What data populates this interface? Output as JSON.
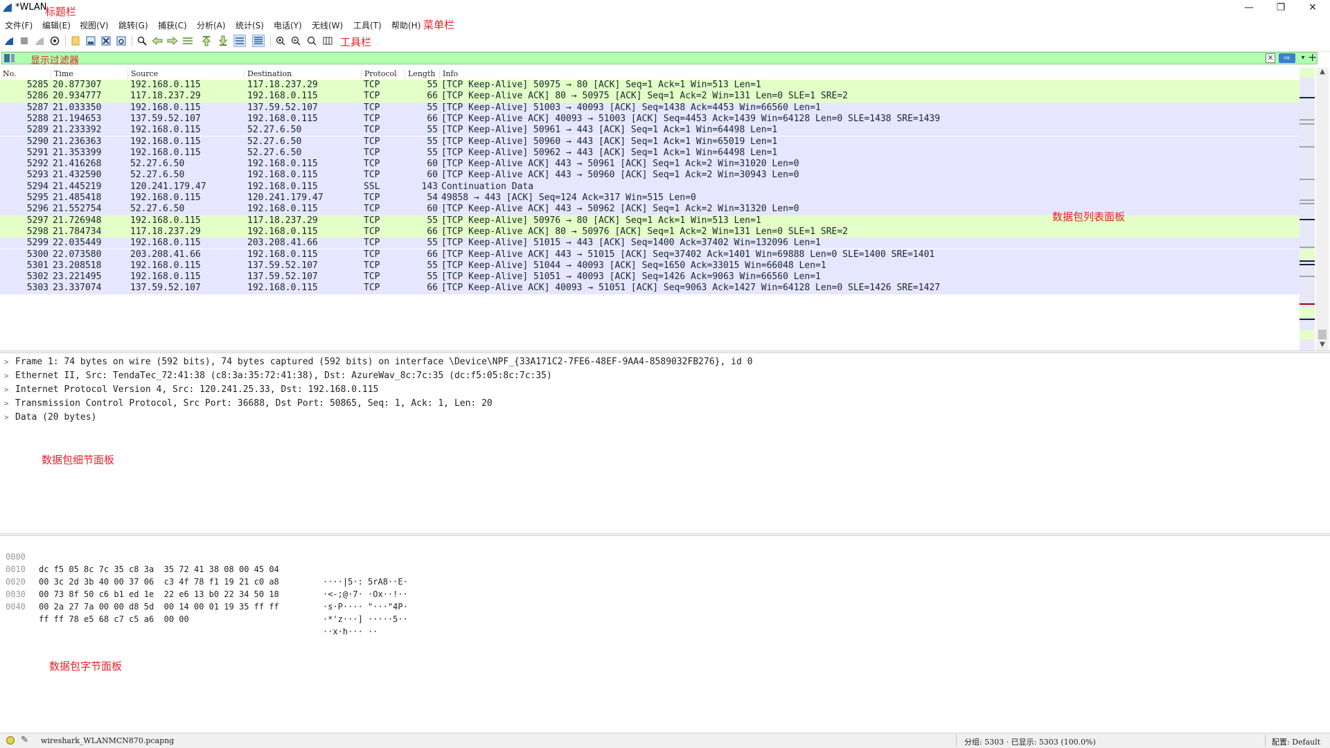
{
  "window": {
    "title": "*WLAN",
    "minimize": "—",
    "maximize": "❐",
    "close": "✕"
  },
  "annotations": {
    "title_bar": "标题栏",
    "menu_bar": "菜单栏",
    "toolbar": "工具栏",
    "display_filter": "显示过滤器",
    "packet_list": "数据包列表面板",
    "packet_details": "数据包细节面板",
    "packet_bytes": "数据包字节面板"
  },
  "menu": [
    {
      "label": "文件(F)"
    },
    {
      "label": "编辑(E)"
    },
    {
      "label": "视图(V)"
    },
    {
      "label": "跳转(G)"
    },
    {
      "label": "捕获(C)"
    },
    {
      "label": "分析(A)"
    },
    {
      "label": "统计(S)"
    },
    {
      "label": "电话(Y)"
    },
    {
      "label": "无线(W)"
    },
    {
      "label": "工具(T)"
    },
    {
      "label": "帮助(H)"
    }
  ],
  "toolbar_icons": [
    "shark-fin-start-icon",
    "stop-capture-icon",
    "restart-capture-icon",
    "capture-options-icon",
    "open-file-icon",
    "save-file-icon",
    "close-file-icon",
    "reload-file-icon",
    "find-packet-icon",
    "go-back-icon",
    "go-forward-icon",
    "go-to-packet-icon",
    "go-first-icon",
    "go-last-icon",
    "auto-scroll-icon",
    "colorize-icon",
    "zoom-in-icon",
    "zoom-out-icon",
    "zoom-normal-icon",
    "resize-columns-icon"
  ],
  "filter": {
    "placeholder": "",
    "clear": "✕",
    "apply": "⇨",
    "dropdown": "▾",
    "add": "+"
  },
  "packet_list": {
    "columns": [
      "No.",
      "Time",
      "Source",
      "Destination",
      "Protocol",
      "Length",
      "Info"
    ],
    "rows": [
      {
        "no": "5285",
        "time": "20.877307",
        "src": "192.168.0.115",
        "dst": "117.18.237.29",
        "proto": "TCP",
        "len": "55",
        "info": "[TCP Keep-Alive] 50975 → 80 [ACK] Seq=1 Ack=1 Win=513 Len=1",
        "bg": "#e4ffc7"
      },
      {
        "no": "5286",
        "time": "20.934777",
        "src": "117.18.237.29",
        "dst": "192.168.0.115",
        "proto": "TCP",
        "len": "66",
        "info": "[TCP Keep-Alive ACK] 80 → 50975 [ACK] Seq=1 Ack=2 Win=131 Len=0 SLE=1 SRE=2",
        "bg": "#e4ffc7"
      },
      {
        "no": "5287",
        "time": "21.033350",
        "src": "192.168.0.115",
        "dst": "137.59.52.107",
        "proto": "TCP",
        "len": "55",
        "info": "[TCP Keep-Alive] 51003 → 40093 [ACK] Seq=1438 Ack=4453 Win=66560 Len=1",
        "bg": "#e7e6ff"
      },
      {
        "no": "5288",
        "time": "21.194653",
        "src": "137.59.52.107",
        "dst": "192.168.0.115",
        "proto": "TCP",
        "len": "66",
        "info": "[TCP Keep-Alive ACK] 40093 → 51003 [ACK] Seq=4453 Ack=1439 Win=64128 Len=0 SLE=1438 SRE=1439",
        "bg": "#e7e6ff"
      },
      {
        "no": "5289",
        "time": "21.233392",
        "src": "192.168.0.115",
        "dst": "52.27.6.50",
        "proto": "TCP",
        "len": "55",
        "info": "[TCP Keep-Alive] 50961 → 443 [ACK] Seq=1 Ack=1 Win=64498 Len=1",
        "bg": "#e7e6ff"
      },
      {
        "no": "5290",
        "time": "21.236363",
        "src": "192.168.0.115",
        "dst": "52.27.6.50",
        "proto": "TCP",
        "len": "55",
        "info": "[TCP Keep-Alive] 50960 → 443 [ACK] Seq=1 Ack=1 Win=65019 Len=1",
        "bg": "#e7e6ff"
      },
      {
        "no": "5291",
        "time": "21.353399",
        "src": "192.168.0.115",
        "dst": "52.27.6.50",
        "proto": "TCP",
        "len": "55",
        "info": "[TCP Keep-Alive] 50962 → 443 [ACK] Seq=1 Ack=1 Win=64498 Len=1",
        "bg": "#e7e6ff"
      },
      {
        "no": "5292",
        "time": "21.416268",
        "src": "52.27.6.50",
        "dst": "192.168.0.115",
        "proto": "TCP",
        "len": "60",
        "info": "[TCP Keep-Alive ACK] 443 → 50961 [ACK] Seq=1 Ack=2 Win=31020 Len=0",
        "bg": "#e7e6ff"
      },
      {
        "no": "5293",
        "time": "21.432590",
        "src": "52.27.6.50",
        "dst": "192.168.0.115",
        "proto": "TCP",
        "len": "60",
        "info": "[TCP Keep-Alive ACK] 443 → 50960 [ACK] Seq=1 Ack=2 Win=30943 Len=0",
        "bg": "#e7e6ff"
      },
      {
        "no": "5294",
        "time": "21.445219",
        "src": "120.241.179.47",
        "dst": "192.168.0.115",
        "proto": "SSL",
        "len": "143",
        "info": "Continuation Data",
        "bg": "#e7e6ff"
      },
      {
        "no": "5295",
        "time": "21.485418",
        "src": "192.168.0.115",
        "dst": "120.241.179.47",
        "proto": "TCP",
        "len": "54",
        "info": "49858 → 443 [ACK] Seq=124 Ack=317 Win=515 Len=0",
        "bg": "#e7e6ff"
      },
      {
        "no": "5296",
        "time": "21.552754",
        "src": "52.27.6.50",
        "dst": "192.168.0.115",
        "proto": "TCP",
        "len": "60",
        "info": "[TCP Keep-Alive ACK] 443 → 50962 [ACK] Seq=1 Ack=2 Win=31320 Len=0",
        "bg": "#e7e6ff"
      },
      {
        "no": "5297",
        "time": "21.726948",
        "src": "192.168.0.115",
        "dst": "117.18.237.29",
        "proto": "TCP",
        "len": "55",
        "info": "[TCP Keep-Alive] 50976 → 80 [ACK] Seq=1 Ack=1 Win=513 Len=1",
        "bg": "#e4ffc7"
      },
      {
        "no": "5298",
        "time": "21.784734",
        "src": "117.18.237.29",
        "dst": "192.168.0.115",
        "proto": "TCP",
        "len": "66",
        "info": "[TCP Keep-Alive ACK] 80 → 50976 [ACK] Seq=1 Ack=2 Win=131 Len=0 SLE=1 SRE=2",
        "bg": "#e4ffc7"
      },
      {
        "no": "5299",
        "time": "22.035449",
        "src": "192.168.0.115",
        "dst": "203.208.41.66",
        "proto": "TCP",
        "len": "55",
        "info": "[TCP Keep-Alive] 51015 → 443 [ACK] Seq=1400 Ack=37402 Win=132096 Len=1",
        "bg": "#e7e6ff"
      },
      {
        "no": "5300",
        "time": "22.073580",
        "src": "203.208.41.66",
        "dst": "192.168.0.115",
        "proto": "TCP",
        "len": "66",
        "info": "[TCP Keep-Alive ACK] 443 → 51015 [ACK] Seq=37402 Ack=1401 Win=69888 Len=0 SLE=1400 SRE=1401",
        "bg": "#e7e6ff"
      },
      {
        "no": "5301",
        "time": "23.208518",
        "src": "192.168.0.115",
        "dst": "137.59.52.107",
        "proto": "TCP",
        "len": "55",
        "info": "[TCP Keep-Alive] 51044 → 40093 [ACK] Seq=1650 Ack=33015 Win=66048 Len=1",
        "bg": "#e7e6ff"
      },
      {
        "no": "5302",
        "time": "23.221495",
        "src": "192.168.0.115",
        "dst": "137.59.52.107",
        "proto": "TCP",
        "len": "55",
        "info": "[TCP Keep-Alive] 51051 → 40093 [ACK] Seq=1426 Ack=9063 Win=66560 Len=1",
        "bg": "#e7e6ff"
      },
      {
        "no": "5303",
        "time": "23.337074",
        "src": "137.59.52.107",
        "dst": "192.168.0.115",
        "proto": "TCP",
        "len": "66",
        "info": "[TCP Keep-Alive ACK] 40093 → 51051 [ACK] Seq=9063 Ack=1427 Win=64128 Len=0 SLE=1426 SRE=1427",
        "bg": "#e7e6ff"
      }
    ]
  },
  "details": [
    "Frame 1: 74 bytes on wire (592 bits), 74 bytes captured (592 bits) on interface \\Device\\NPF_{33A171C2-7FE6-48EF-9AA4-8589032FB276}, id 0",
    "Ethernet II, Src: TendaTec_72:41:38 (c8:3a:35:72:41:38), Dst: AzureWav_8c:7c:35 (dc:f5:05:8c:7c:35)",
    "Internet Protocol Version 4, Src: 120.241.25.33, Dst: 192.168.0.115",
    "Transmission Control Protocol, Src Port: 36688, Dst Port: 50865, Seq: 1, Ack: 1, Len: 20",
    "Data (20 bytes)"
  ],
  "bytes": [
    {
      "offset": "0000",
      "hex": "dc f5 05 8c 7c 35 c8 3a  35 72 41 38 08 00 45 04",
      "ascii": "····|5·: 5rA8··E·"
    },
    {
      "offset": "0010",
      "hex": "00 3c 2d 3b 40 00 37 06  c3 4f 78 f1 19 21 c0 a8",
      "ascii": "·<-;@·7· ·Ox··!··"
    },
    {
      "offset": "0020",
      "hex": "00 73 8f 50 c6 b1 ed 1e  22 e6 13 b0 22 34 50 18",
      "ascii": "·s·P···· \"···\"4P·"
    },
    {
      "offset": "0030",
      "hex": "00 2a 27 7a 00 00 d8 5d  00 14 00 01 19 35 ff ff",
      "ascii": "·*'z···] ·····5··"
    },
    {
      "offset": "0040",
      "hex": "ff ff 78 e5 68 c7 c5 a6  00 00",
      "ascii": "··x·h··· ··"
    }
  ],
  "status": {
    "file": "wireshark_WLANMCN870.pcapng",
    "packets": "分组: 5303 · 已显示: 5303 (100.0%)",
    "profile": "配置: Default"
  },
  "colors": {
    "tcp_row": "#e7e6ff",
    "http_row": "#e4ffc7",
    "filter_bg": "#afffaf",
    "annotation": "#e8202a"
  }
}
